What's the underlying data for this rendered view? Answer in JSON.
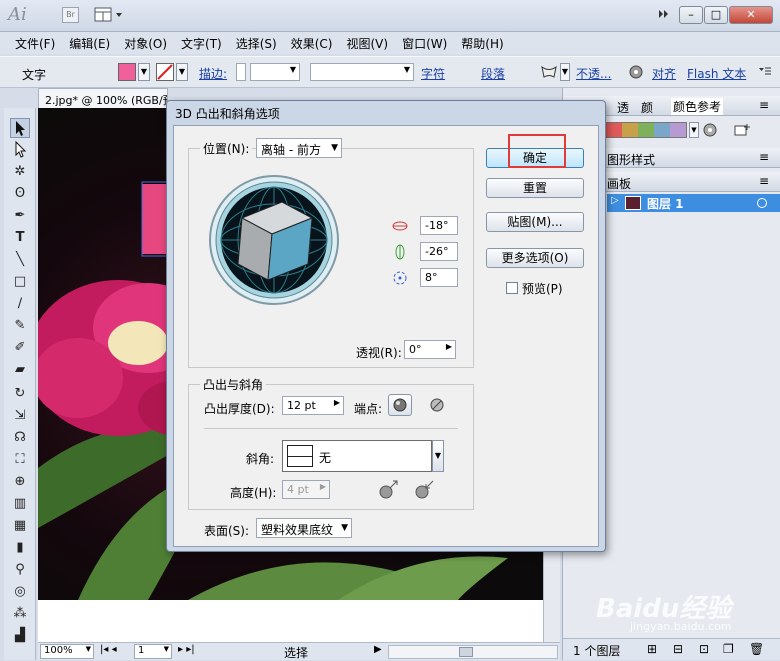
{
  "app": {
    "logo": "Ai",
    "br_label": "Br"
  },
  "menubar": {
    "items": [
      "文件(F)",
      "编辑(E)",
      "对象(O)",
      "文字(T)",
      "选择(S)",
      "效果(C)",
      "视图(V)",
      "窗口(W)",
      "帮助(H)"
    ]
  },
  "control_bar": {
    "mode_label": "文字",
    "fill_color": "#f0609a",
    "stroke_label": "描边:",
    "char_link": "字符",
    "para_link": "段落",
    "opacity_link": "不透...",
    "align_link": "对齐",
    "flash_link": "Flash 文本"
  },
  "document": {
    "tab_title": "2.jpg* @ 100% (RGB/预览)",
    "zoom": "100%",
    "page": "1",
    "status": "选择"
  },
  "dialog": {
    "title": "3D 凸出和斜角选项",
    "position_label": "位置(N):",
    "position_value": "离轴 - 前方",
    "rot_x": "-18°",
    "rot_y": "-26°",
    "rot_z": "8°",
    "perspective_label": "透视(R):",
    "perspective_value": "0°",
    "extrude_group_label": "凸出与斜角",
    "extrude_depth_label": "凸出厚度(D):",
    "extrude_depth_value": "12 pt",
    "cap_label": "端点:",
    "bevel_label": "斜角:",
    "bevel_value": "无",
    "height_label": "高度(H):",
    "height_value": "4 pt",
    "surface_label": "表面(S):",
    "surface_value": "塑料效果底纹",
    "ok_label": "确定",
    "reset_label": "重置",
    "map_label": "贴图(M)...",
    "more_label": "更多选项(O)",
    "preview_label": "预览(P)"
  },
  "right_panel": {
    "tabs": [
      "透",
      "颜",
      "颜色参考"
    ],
    "graphic_styles": "图形样式",
    "artboards": "画板",
    "layer_name": "图层 1",
    "layers_count": "1 个图层",
    "swatches": [
      "#e05a5a",
      "#c7a04a",
      "#7fb05a",
      "#7aa6c9",
      "#b79ad1"
    ]
  },
  "watermark": {
    "brand": "Baidu经验",
    "url": "jingyan.baidu.com"
  }
}
